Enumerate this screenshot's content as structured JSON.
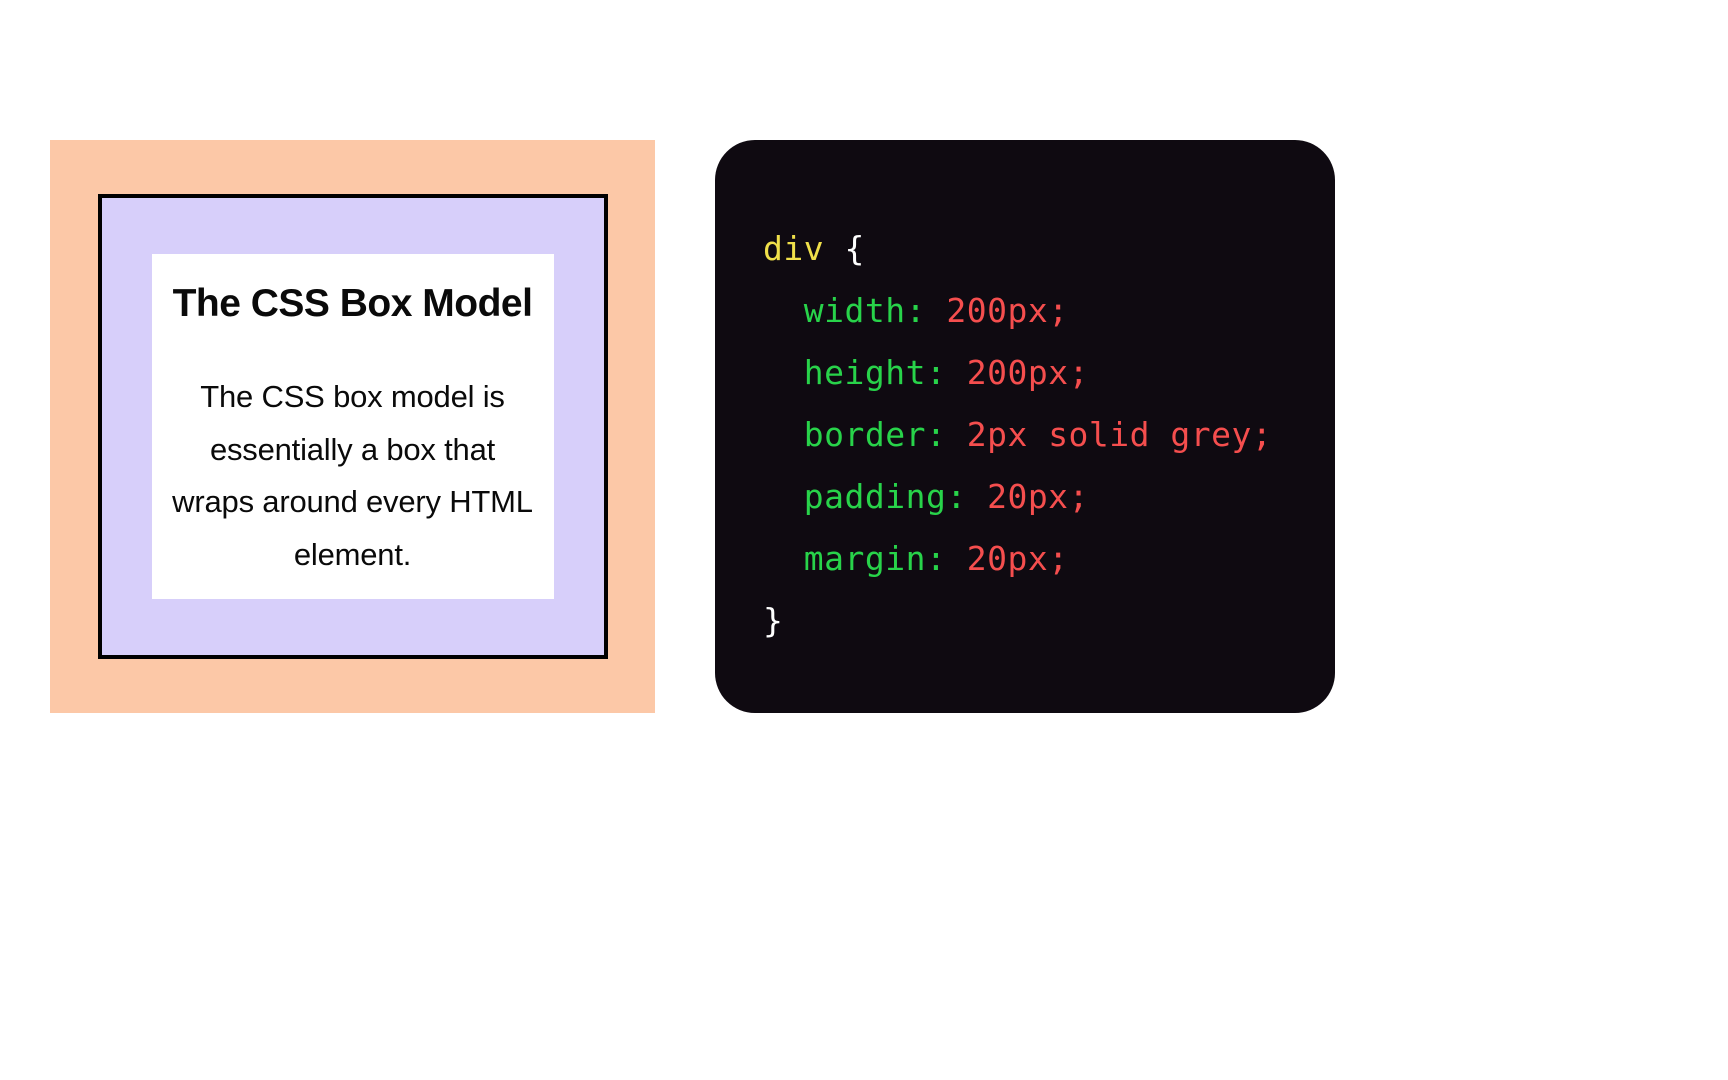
{
  "diagram": {
    "title": "The CSS Box Model",
    "description": "The CSS box model is essentially a box that wraps around every HTML element."
  },
  "code": {
    "selector": "div",
    "brace_open": " {",
    "brace_close": "}",
    "lines": [
      {
        "property": "width",
        "value": "200px"
      },
      {
        "property": "height",
        "value": "200px"
      },
      {
        "property": "border",
        "value": "2px solid grey"
      },
      {
        "property": "padding",
        "value": "20px"
      },
      {
        "property": "margin",
        "value": "20px"
      }
    ]
  }
}
